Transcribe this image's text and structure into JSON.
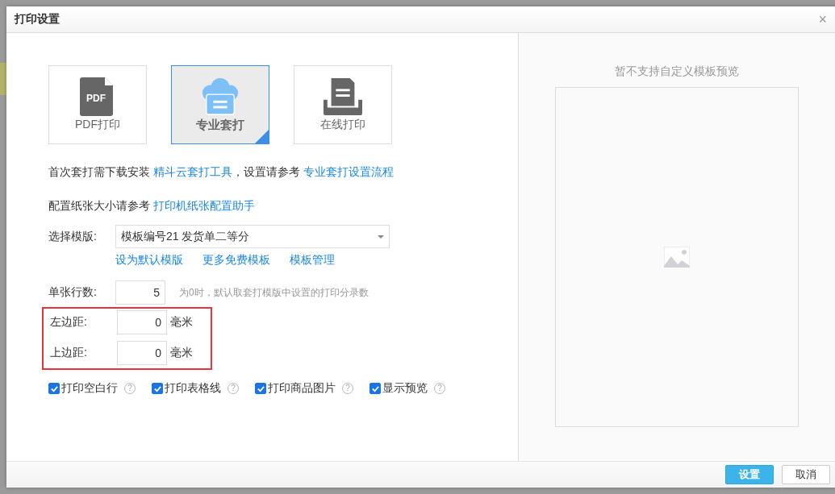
{
  "dialog": {
    "title": "打印设置",
    "close": "×"
  },
  "print_modes": [
    {
      "label": "PDF打印",
      "kind": "pdf",
      "icon_text": "PDF",
      "selected": false
    },
    {
      "label": "专业套打",
      "kind": "cloud",
      "selected": true
    },
    {
      "label": "在线打印",
      "kind": "printer",
      "selected": false
    }
  ],
  "notes": [
    [
      {
        "text": "首次套打需下载安装 ",
        "kind": "plain"
      },
      {
        "text": "精斗云套打工具",
        "kind": "link"
      },
      {
        "text": "，设置请参考 ",
        "kind": "plain"
      },
      {
        "text": "专业套打设置流程",
        "kind": "link"
      }
    ],
    [
      {
        "text": "配置纸张大小请参考 ",
        "kind": "plain"
      },
      {
        "text": "打印机纸张配置助手",
        "kind": "link"
      }
    ]
  ],
  "template": {
    "label": "选择模版:",
    "value": "模板编号21 发货单二等分",
    "links": [
      "设为默认模版",
      "更多免费模板",
      "模板管理"
    ]
  },
  "rows_per_sheet": {
    "label": "单张行数:",
    "value": "5",
    "hint": "为0时，默认取套打模版中设置的打印分录数"
  },
  "margins": {
    "highlighted": true,
    "fields": [
      {
        "label": "左边距:",
        "value": "0",
        "unit": "毫米"
      },
      {
        "label": "上边距:",
        "value": "0",
        "unit": "毫米"
      }
    ]
  },
  "options": [
    {
      "label": "打印空白行",
      "checked": true,
      "help": "?"
    },
    {
      "label": "打印表格线",
      "checked": true,
      "help": "?"
    },
    {
      "label": "打印商品图片",
      "checked": true,
      "help": "?"
    },
    {
      "label": "显示预览",
      "checked": true,
      "help": "?"
    }
  ],
  "preview": {
    "message": "暂不支持自定义模板预览"
  },
  "buttons": [
    {
      "label": "设置",
      "kind": "primary"
    },
    {
      "label": "取消",
      "kind": "default"
    }
  ]
}
